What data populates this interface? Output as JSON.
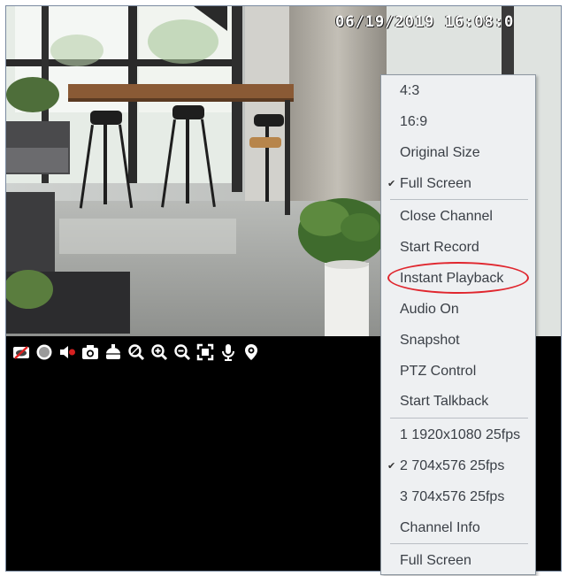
{
  "video": {
    "timestamp": "06/19/2019  16:08:0"
  },
  "toolbar": {
    "buttons": [
      {
        "icon": "hide-toolbar-icon"
      },
      {
        "icon": "record-icon"
      },
      {
        "icon": "audio-off-icon"
      },
      {
        "icon": "snapshot-icon"
      },
      {
        "icon": "ptz-icon"
      },
      {
        "icon": "zoom-icon"
      },
      {
        "icon": "zoom-in-icon"
      },
      {
        "icon": "zoom-out-icon"
      },
      {
        "icon": "fullscreen-icon"
      },
      {
        "icon": "microphone-icon"
      },
      {
        "icon": "location-icon"
      }
    ]
  },
  "context_menu": {
    "items": [
      {
        "label": "4:3",
        "checked": false
      },
      {
        "label": "16:9",
        "checked": false
      },
      {
        "label": "Original Size",
        "checked": false
      },
      {
        "label": "Full Screen",
        "checked": true
      },
      {
        "label": "Close Channel",
        "checked": false
      },
      {
        "label": "Start Record",
        "checked": false
      },
      {
        "label": "Instant Playback",
        "checked": false,
        "highlighted": true
      },
      {
        "label": "Audio On",
        "checked": false
      },
      {
        "label": "Snapshot",
        "checked": false
      },
      {
        "label": "PTZ Control",
        "checked": false
      },
      {
        "label": "Start Talkback",
        "checked": false
      },
      {
        "label": "1 1920x1080 25fps",
        "checked": false
      },
      {
        "label": "2 704x576 25fps",
        "checked": true
      },
      {
        "label": "3 704x576 25fps",
        "checked": false
      },
      {
        "label": "Channel Info",
        "checked": false
      },
      {
        "label": "Full Screen",
        "checked": false
      }
    ],
    "check_mark": "✔",
    "highlight_color": "#e0262e"
  }
}
